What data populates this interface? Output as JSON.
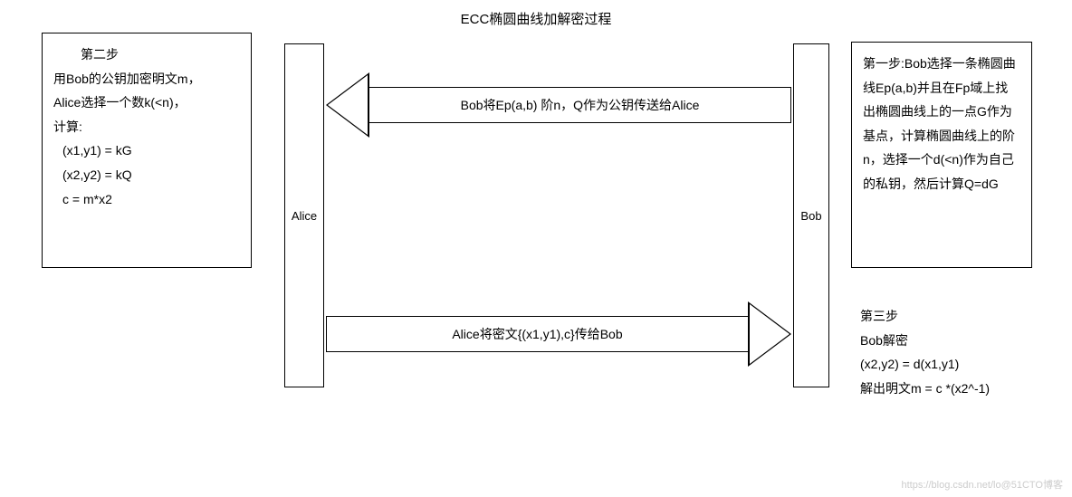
{
  "title": "ECC椭圆曲线加解密过程",
  "alice_label": "Alice",
  "bob_label": "Bob",
  "step2": {
    "heading": "第二步",
    "line1": "用Bob的公钥加密明文m，",
    "line2": "Alice选择一个数k(<n)，",
    "line3": "计算:",
    "f1": "(x1,y1)  = kG",
    "f2": "(x2,y2)  = kQ",
    "f3": "c = m*x2"
  },
  "step1": {
    "text": "第一步:Bob选择一条椭圆曲线Ep(a,b)并且在Fp域上找出椭圆曲线上的一点G作为基点，计算椭圆曲线上的阶n，选择一个d(<n)作为自己的私钥，然后计算Q=dG"
  },
  "step3": {
    "heading": "第三步",
    "line1": "Bob解密",
    "line2": "(x2,y2) = d(x1,y1)",
    "line3": "解出明文m = c *(x2^-1)"
  },
  "arrow_top": "Bob将Ep(a,b) 阶n，Q作为公钥传送给Alice",
  "arrow_bottom": "Alice将密文{(x1,y1),c}传给Bob",
  "watermark": "https://blog.csdn.net/lo@51CTO博客"
}
